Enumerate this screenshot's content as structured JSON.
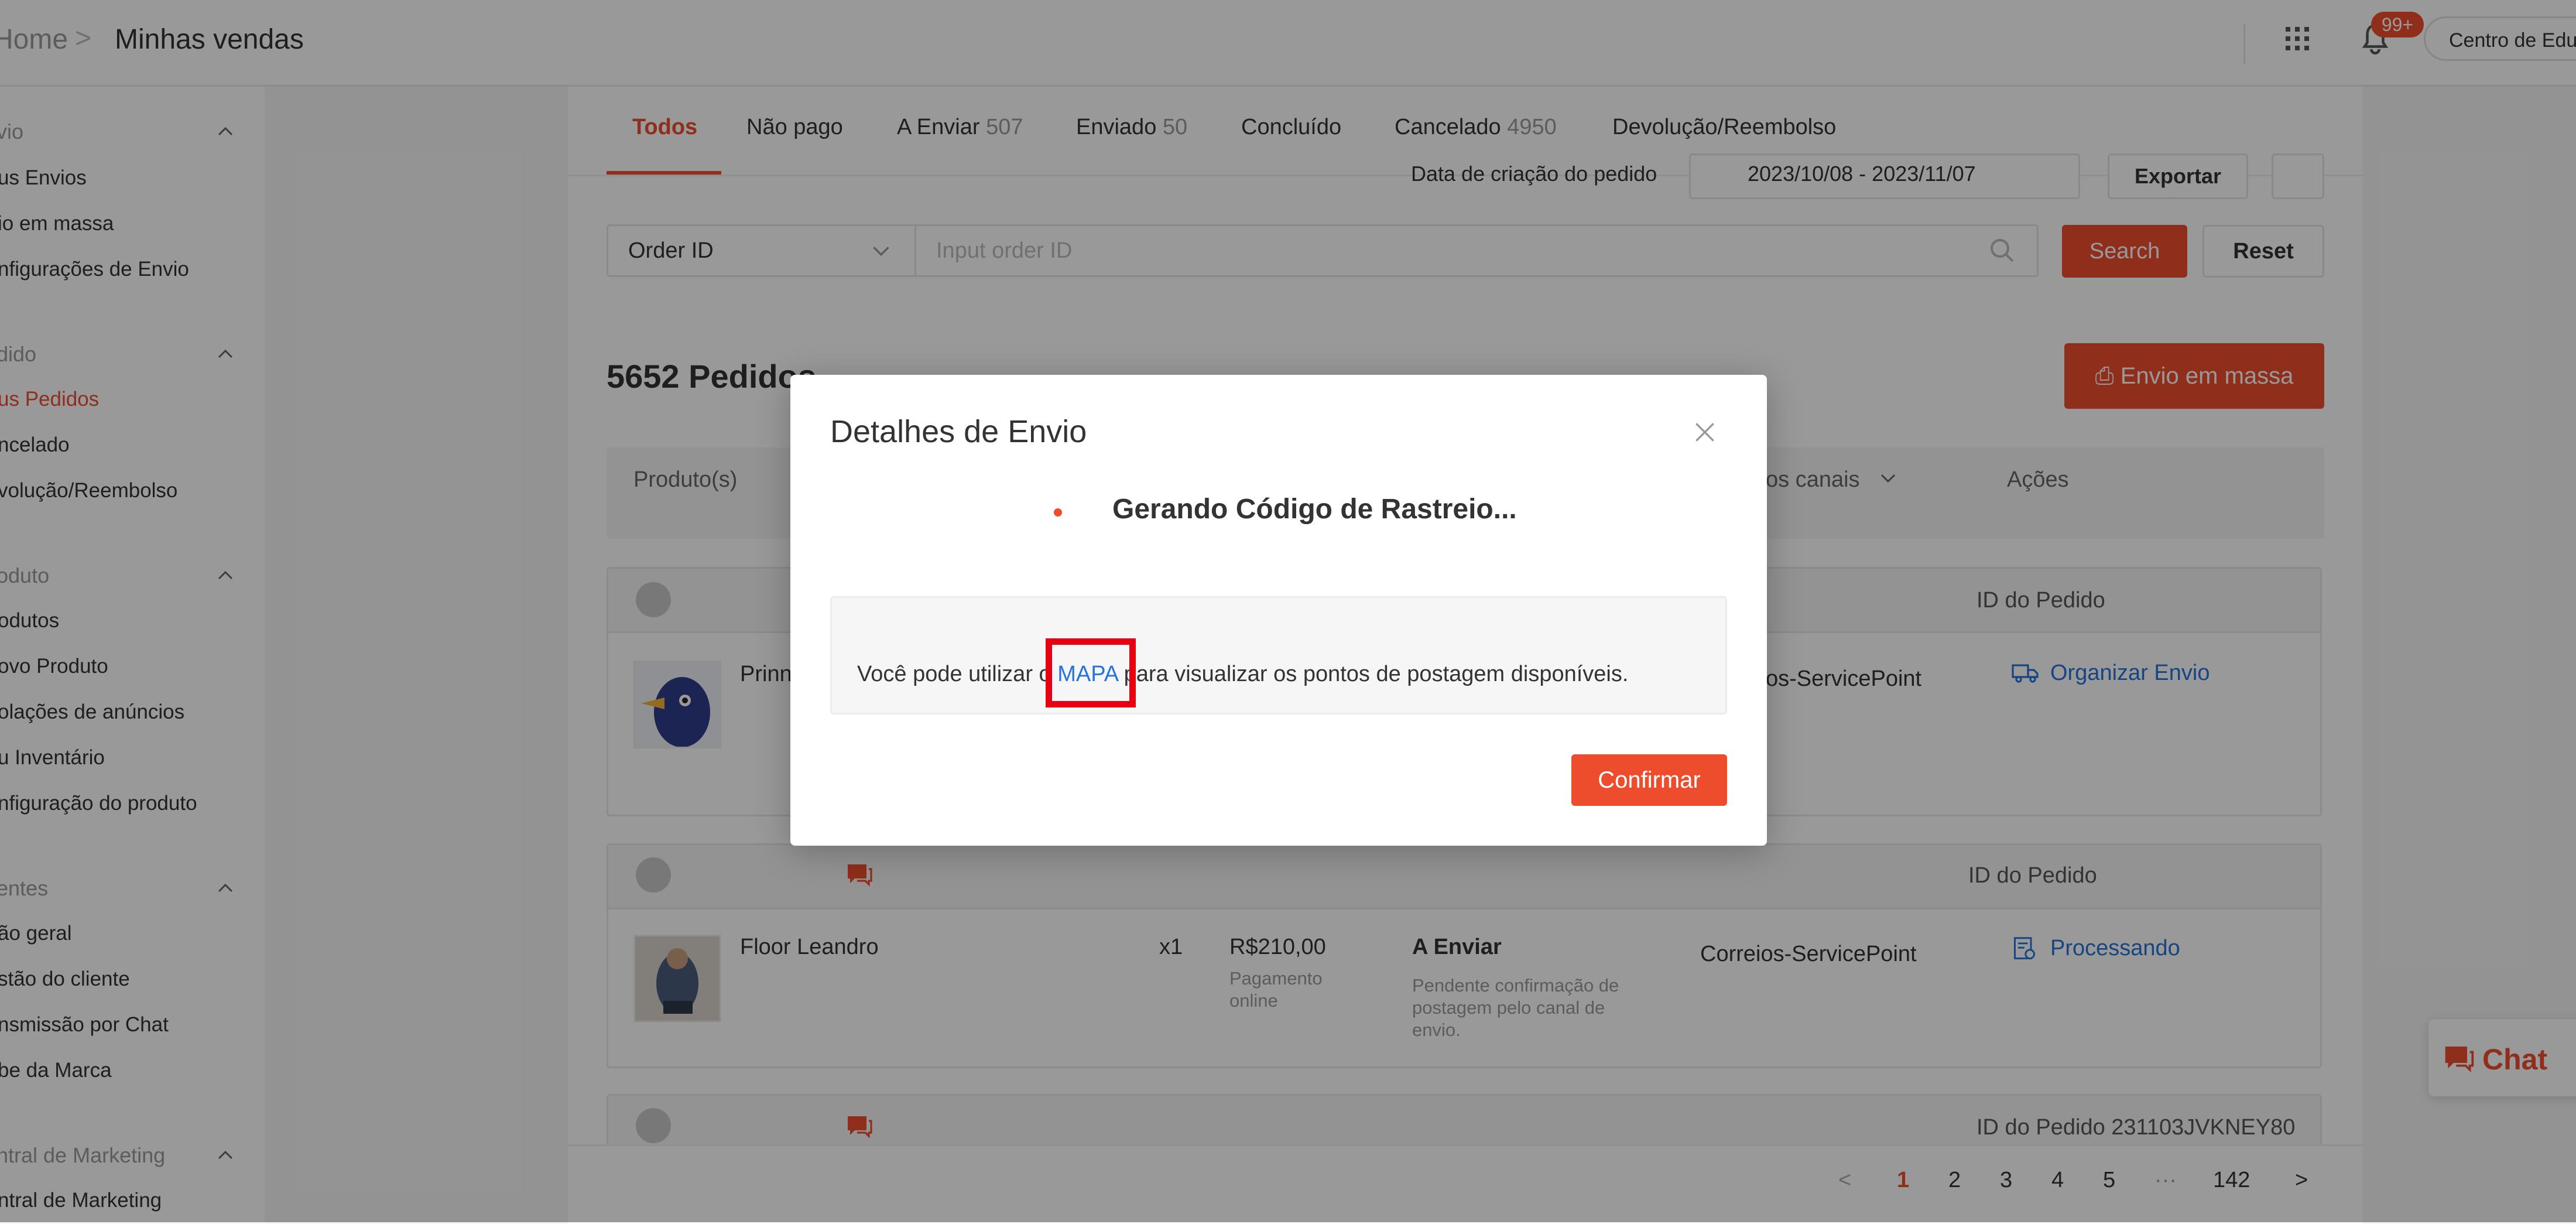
{
  "breadcrumb": {
    "home": "Home",
    "separator": ">",
    "current": "Minhas vendas"
  },
  "header": {
    "notification_badge": "99+",
    "education_center": "Centro de Educ"
  },
  "sidebar": {
    "sections": [
      {
        "title": "vio",
        "items": [
          "us Envios",
          "io em massa",
          "nfigurações de Envio"
        ]
      },
      {
        "title": "dido",
        "items": [
          "us Pedidos",
          "ncelado",
          "volução/Reembolso"
        ]
      },
      {
        "title": "oduto",
        "items": [
          "odutos",
          "ovo Produto",
          "olações de anúncios",
          "u Inventário",
          "nfiguração do produto"
        ]
      },
      {
        "title": "entes",
        "items": [
          "ão geral",
          "stão do cliente",
          "nsmissão por Chat",
          "be da Marca"
        ]
      },
      {
        "title": "ntral de Marketing",
        "items": [
          "ntral de Marketing"
        ]
      }
    ],
    "active_item": "us Pedidos"
  },
  "tabs": [
    {
      "label": "Todos",
      "count": ""
    },
    {
      "label": "Não pago",
      "count": ""
    },
    {
      "label": "A Enviar",
      "count": "507"
    },
    {
      "label": "Enviado",
      "count": "50"
    },
    {
      "label": "Concluído",
      "count": ""
    },
    {
      "label": "Cancelado",
      "count": "4950"
    },
    {
      "label": "Devolução/Reembolso",
      "count": ""
    }
  ],
  "filters": {
    "date_label": "Data de criação do pedido",
    "date_range": "2023/10/08 - 2023/11/07",
    "export_label": "Exportar",
    "search_type": "Order ID",
    "search_placeholder": "Input order ID",
    "search_label": "Search",
    "reset_label": "Reset"
  },
  "orders_count_title": "5652 Pedidos",
  "bulk_ship_label": "Envio em massa",
  "table_headers": {
    "product": "Produto(s)",
    "channels": "os canais",
    "actions": "Ações"
  },
  "orders": [
    {
      "order_id_label": "ID do Pedido",
      "product": "Prinn",
      "channel": "os-ServicePoint",
      "action": "Organizar Envio"
    },
    {
      "order_id_label": "ID do Pedido",
      "product": "Floor Leandro",
      "qty": "x1",
      "price": "R$210,00",
      "payment": "Pagamento online",
      "status": "A Enviar",
      "status_note": "Pendente confirmação de postagem pelo canal de envio.",
      "channel": "Correios-ServicePoint",
      "action": "Processando"
    },
    {
      "order_id_label": "ID do Pedido 231103JVKNEY80"
    }
  ],
  "pagination": {
    "prev": "<",
    "pages": [
      "1",
      "2",
      "3",
      "4",
      "5",
      "···",
      "142"
    ],
    "next": ">",
    "current": "1"
  },
  "chat_widget": {
    "label": "Chat"
  },
  "modal": {
    "title": "Detalhes de Envio",
    "generating_text": "Gerando Código de Rastreio...",
    "info_prefix": "Você pode utilizar o",
    "info_link": "MAPA",
    "info_suffix": "para visualizar os pontos de postagem disponíveis.",
    "confirm_label": "Confirmar"
  },
  "colors": {
    "accent": "#ee4d2d",
    "link": "#2673dd",
    "highlight": "#e60012"
  }
}
